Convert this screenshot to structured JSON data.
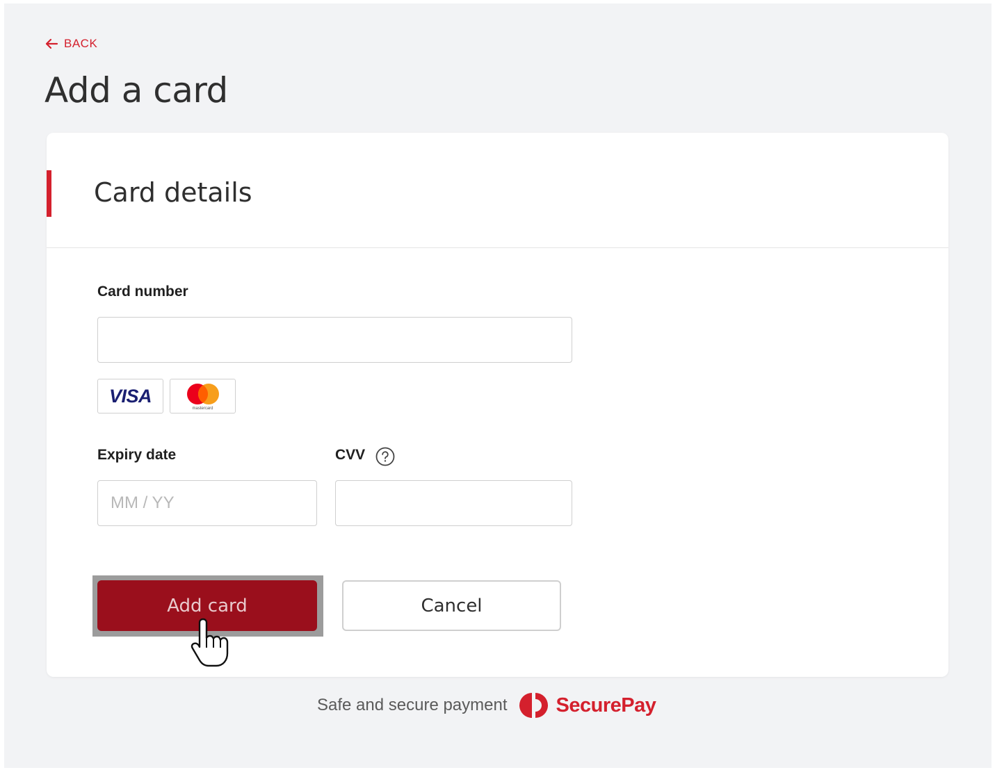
{
  "nav": {
    "back_label": "BACK"
  },
  "page": {
    "title": "Add a card"
  },
  "card": {
    "section_title": "Card details",
    "card_number": {
      "label": "Card number",
      "value": "",
      "placeholder": ""
    },
    "brands": [
      {
        "name": "VISA",
        "icon": "visa-logo"
      },
      {
        "name": "mastercard",
        "icon": "mastercard-logo"
      }
    ],
    "expiry": {
      "label": "Expiry date",
      "value": "",
      "placeholder": "MM / YY"
    },
    "cvv": {
      "label": "CVV",
      "value": "",
      "placeholder": "",
      "help_icon": "question-circle-icon"
    },
    "actions": {
      "primary_label": "Add card",
      "secondary_label": "Cancel"
    }
  },
  "footer": {
    "text": "Safe and secure payment",
    "brand": "SecurePay"
  },
  "colors": {
    "accent": "#d4202d",
    "primary_button": "#9a0f1c",
    "background": "#f2f3f5",
    "card": "#ffffff"
  }
}
